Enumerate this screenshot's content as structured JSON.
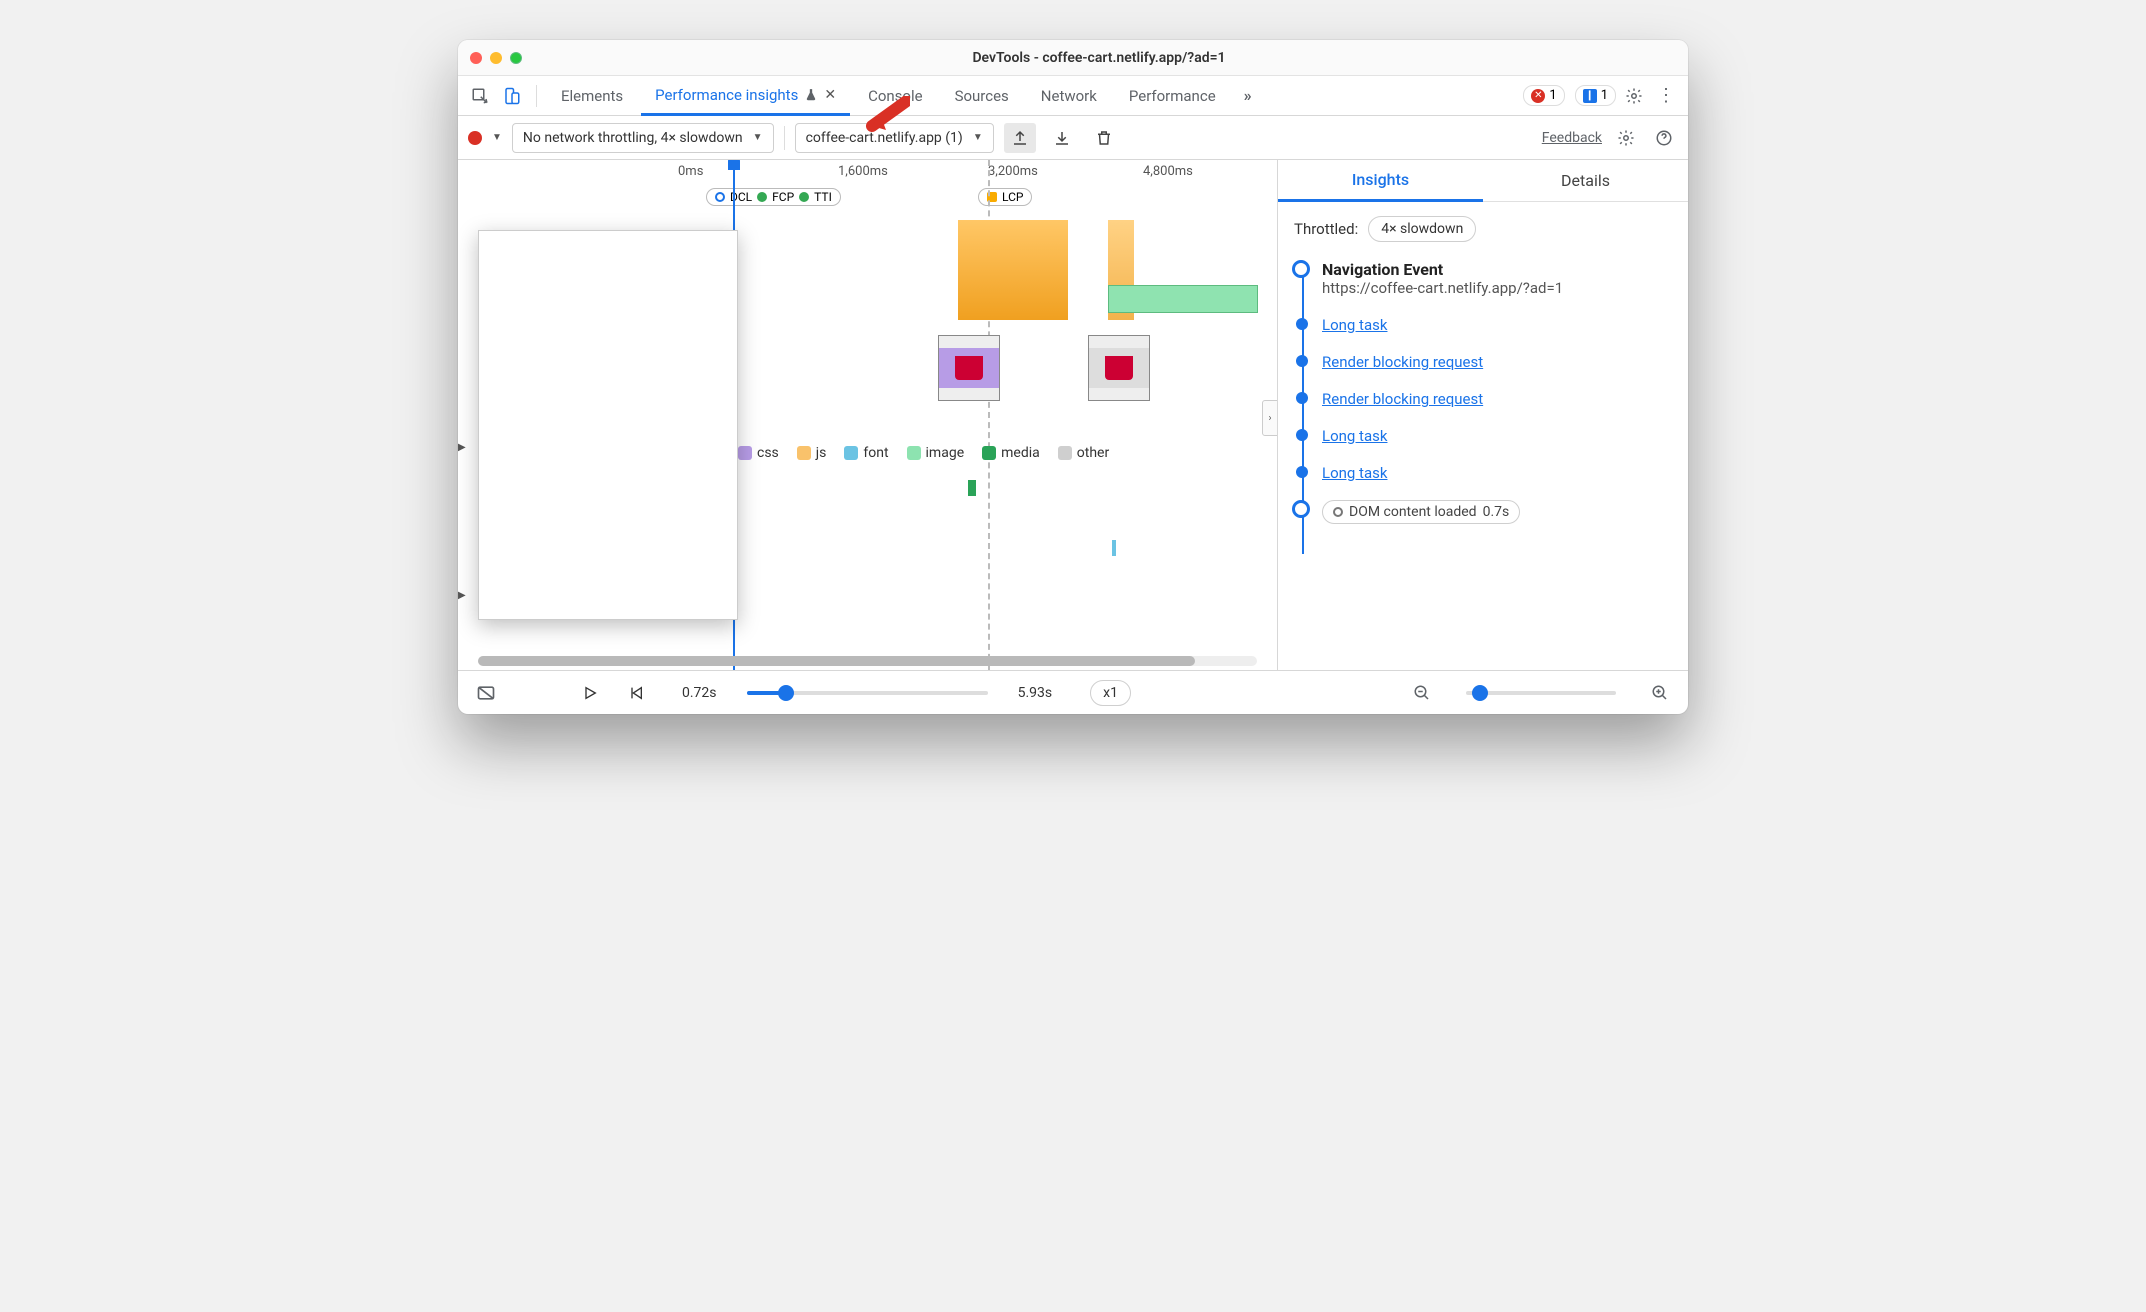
{
  "window_title": "DevTools - coffee-cart.netlify.app/?ad=1",
  "tabs": {
    "elements": "Elements",
    "perf_insights": "Performance insights",
    "console": "Console",
    "sources": "Sources",
    "network": "Network",
    "performance": "Performance"
  },
  "badges": {
    "errors": "1",
    "issues": "1"
  },
  "toolbar": {
    "throttle_select": "No network throttling, 4× slowdown",
    "page_select": "coffee-cart.netlify.app (1)",
    "feedback": "Feedback"
  },
  "ruler": {
    "t0": "0ms",
    "t1": "1,600ms",
    "t2": "3,200ms",
    "t3": "4,800ms"
  },
  "markers": {
    "dcl": "DCL",
    "fcp": "FCP",
    "tti": "TTI",
    "lcp": "LCP"
  },
  "legend": {
    "css": "css",
    "js": "js",
    "font": "font",
    "image": "image",
    "media": "media",
    "other": "other"
  },
  "side": {
    "insights_tab": "Insights",
    "details_tab": "Details",
    "throttled_label": "Throttled:",
    "throttled_value": "4× slowdown",
    "nav_title": "Navigation Event",
    "nav_url": "https://coffee-cart.netlify.app/?ad=1",
    "items": {
      "long1": "Long task",
      "rb1": "Render blocking request",
      "rb2": "Render blocking request",
      "long2": "Long task",
      "long3": "Long task",
      "dcl": "DOM content loaded",
      "dcl_time": "0.7s"
    }
  },
  "footer": {
    "start": "0.72s",
    "end": "5.93s",
    "speed": "x1"
  },
  "colors": {
    "dcl": "#1a73e8",
    "fcp": "#34a853",
    "tti": "#34a853",
    "lcp": "#f9ab00",
    "css": "#b79ce6",
    "js": "#f9c26b",
    "font": "#6bc3e3",
    "image": "#8de3b0",
    "media": "#2aa358",
    "other": "#cfcfcf"
  }
}
